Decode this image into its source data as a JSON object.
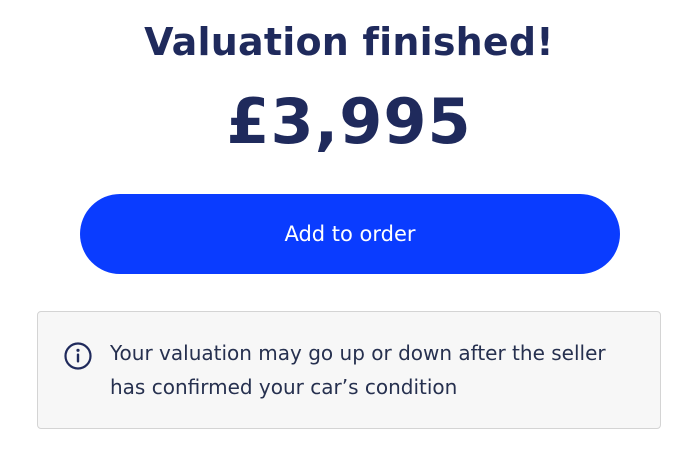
{
  "title": "Valuation finished!",
  "price": "£3,995",
  "cta": {
    "label": "Add to order"
  },
  "notice": {
    "icon": "info-circle-icon",
    "text": "Your valuation may go up or down after the seller has confirmed your car’s condition"
  },
  "colors": {
    "heading": "#1f2a5c",
    "button": "#0a3cff",
    "notice_bg": "#f7f7f7",
    "notice_border": "#d4d4d4"
  }
}
